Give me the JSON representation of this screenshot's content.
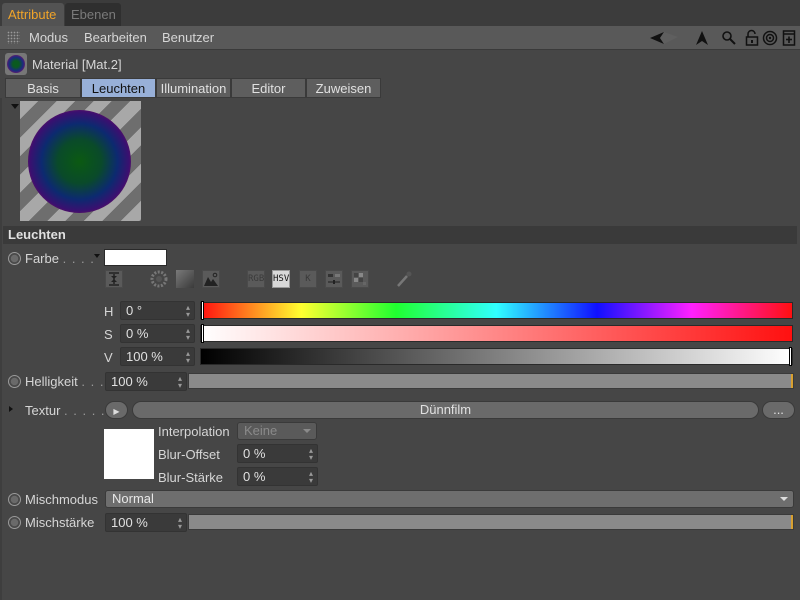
{
  "tabs": [
    {
      "label": "Attribute",
      "active": true
    },
    {
      "label": "Ebenen",
      "active": false
    }
  ],
  "menu": {
    "items": [
      "Modus",
      "Bearbeiten",
      "Benutzer"
    ],
    "tools": [
      "back-arrow-icon",
      "cursor-arrow-icon",
      "search-icon",
      "unlock-icon",
      "target-icon",
      "new-panel-icon"
    ]
  },
  "material": {
    "title": "Material [Mat.2]"
  },
  "subtabs": [
    {
      "label": "Basis",
      "active": false
    },
    {
      "label": "Leuchten",
      "active": true
    },
    {
      "label": "Illumination",
      "active": false
    },
    {
      "label": "Editor",
      "active": false
    },
    {
      "label": "Zuweisen",
      "active": false
    }
  ],
  "section": {
    "title": "Leuchten"
  },
  "farbe": {
    "label": "Farbe",
    "dots": ". . . .",
    "swatch_color": "#ffffff",
    "modes": [
      {
        "name": "spectrum-icon",
        "label": ""
      },
      {
        "name": "color-wheel-icon",
        "label": ""
      },
      {
        "name": "gradient-square-icon",
        "label": ""
      },
      {
        "name": "image-picker-icon",
        "label": ""
      },
      {
        "name": "rgb-mode",
        "label": "RGB"
      },
      {
        "name": "hsv-mode",
        "label": "HSV",
        "active": true
      },
      {
        "name": "kelvin-mode",
        "label": "K"
      },
      {
        "name": "mixer-icon",
        "label": ""
      },
      {
        "name": "swatches-icon",
        "label": ""
      }
    ],
    "h": {
      "letter": "H",
      "value": "0 °",
      "position": 0
    },
    "s": {
      "letter": "S",
      "value": "0 %",
      "position": 0
    },
    "v": {
      "letter": "V",
      "value": "100 %",
      "position": 1
    }
  },
  "helligkeit": {
    "label": "Helligkeit",
    "dots": ". . .",
    "value": "100 %",
    "fraction": 1.0
  },
  "textur": {
    "label": "Textur",
    "dots": ". . . . . .",
    "shader": "Dünnfilm",
    "more_label": "...",
    "interpolation_label": "Interpolation",
    "interpolation_value": "Keine",
    "blur_offset_label": "Blur-Offset",
    "blur_offset_value": "0 %",
    "blur_staerke_label": "Blur-Stärke",
    "blur_staerke_value": "0 %"
  },
  "mischmodus": {
    "label": "Mischmodus",
    "value": "Normal"
  },
  "mischstaerke": {
    "label": "Mischstärke",
    "value": "100 %",
    "fraction": 1.0
  },
  "colors": {
    "accent_tab": "#f0a42a",
    "active_subtab": "#98b0d8",
    "slider_end": "#d8a030"
  }
}
